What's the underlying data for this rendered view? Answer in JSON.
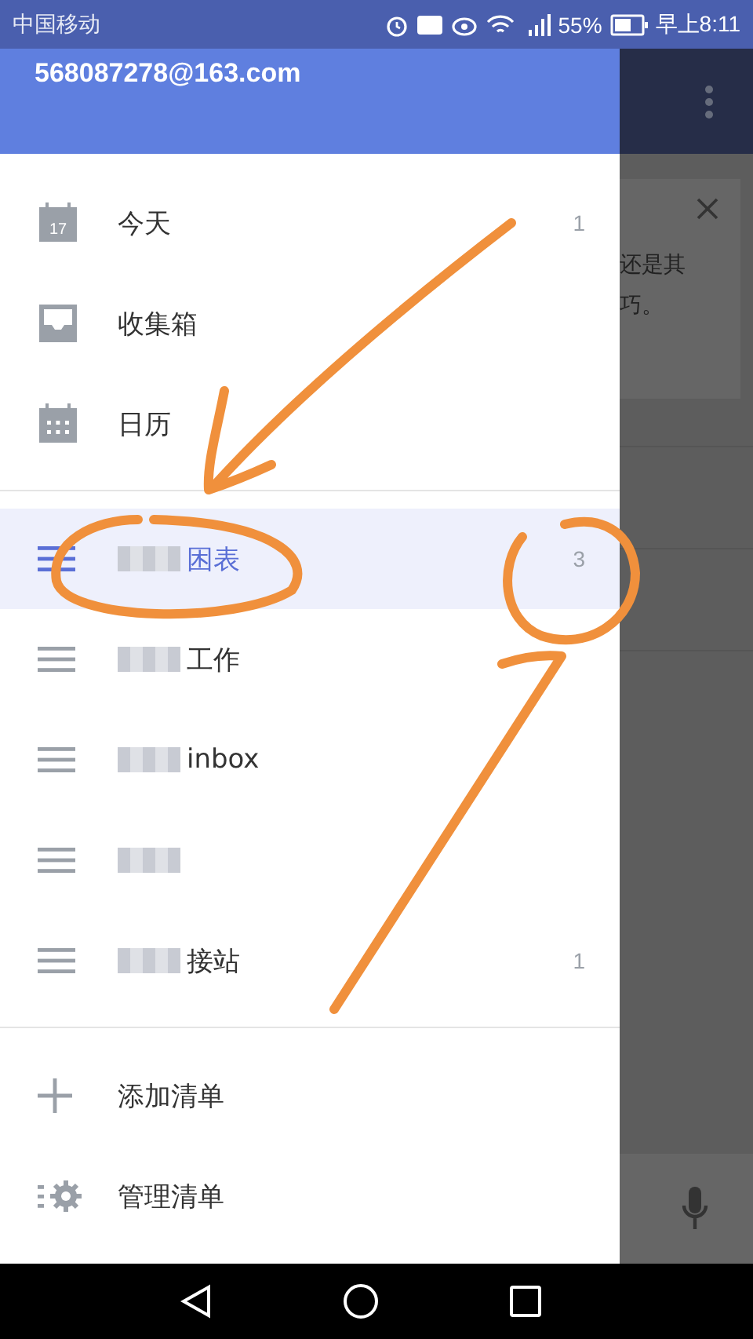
{
  "status_bar": {
    "carrier": "中国移动",
    "battery": "55%",
    "time": "早上8:11"
  },
  "drawer": {
    "account": "568087278@163.com",
    "items": [
      {
        "kind": "today",
        "icon_text": "17",
        "label": "今天",
        "count": "1",
        "selected": false,
        "obscured": false
      },
      {
        "kind": "inbox",
        "label": "收集箱",
        "selected": false,
        "obscured": false
      },
      {
        "kind": "calendar",
        "label": "日历",
        "selected": false,
        "obscured": false
      },
      {
        "kind": "divider"
      },
      {
        "kind": "list",
        "label": "困表",
        "count": "3",
        "selected": true,
        "obscured": true
      },
      {
        "kind": "list",
        "label": "工作",
        "selected": false,
        "obscured": true
      },
      {
        "kind": "list",
        "label": "inbox",
        "selected": false,
        "obscured": true
      },
      {
        "kind": "list",
        "selected": false,
        "obscured": true
      },
      {
        "kind": "list",
        "label": "接站",
        "count": "1",
        "selected": false,
        "obscured": true
      },
      {
        "kind": "divider"
      },
      {
        "kind": "add",
        "label": "添加清单",
        "selected": false,
        "obscured": false
      },
      {
        "kind": "manage",
        "label": "管理清单",
        "selected": false,
        "obscured": false
      }
    ]
  },
  "background": {
    "card_lines": [
      "还是其",
      "巧。"
    ]
  }
}
